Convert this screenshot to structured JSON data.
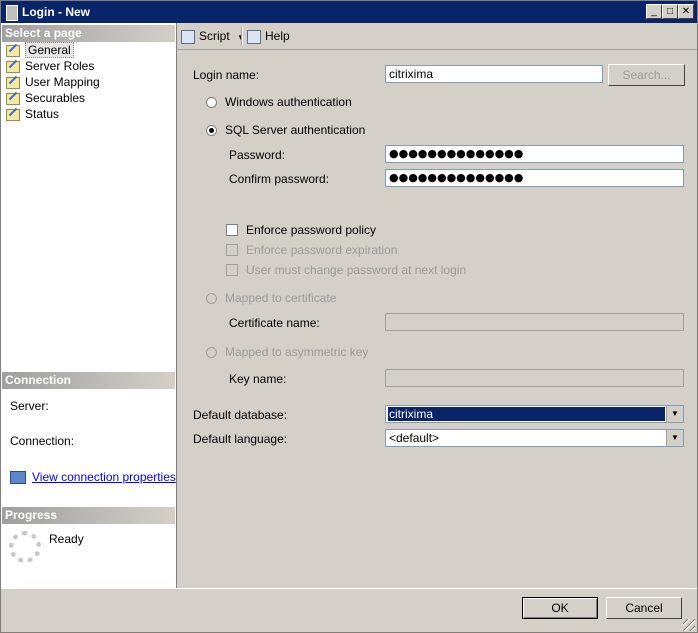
{
  "window": {
    "title": "Login - New"
  },
  "sidebar": {
    "select_header": "Select a page",
    "pages": [
      {
        "label": "General"
      },
      {
        "label": "Server Roles"
      },
      {
        "label": "User Mapping"
      },
      {
        "label": "Securables"
      },
      {
        "label": "Status"
      }
    ],
    "connection_header": "Connection",
    "server_label": "Server:",
    "connection_label": "Connection:",
    "view_link": "View connection properties",
    "progress_header": "Progress",
    "progress_status": "Ready"
  },
  "toolbar": {
    "script_label": "Script",
    "help_label": "Help"
  },
  "form": {
    "login_name_label": "Login name:",
    "login_name_value": "citrixima",
    "search_button": "Search...",
    "windows_auth": "Windows authentication",
    "sql_auth": "SQL Server authentication",
    "password_label": "Password:",
    "password_value": "●●●●●●●●●●●●●●",
    "confirm_label": "Confirm password:",
    "confirm_value": "●●●●●●●●●●●●●●",
    "enforce_policy": "Enforce password policy",
    "enforce_expiration": "Enforce password expiration",
    "must_change": "User must change password at next login",
    "mapped_cert": "Mapped to certificate",
    "cert_name_label": "Certificate name:",
    "mapped_key": "Mapped to asymmetric key",
    "key_name_label": "Key name:",
    "default_db_label": "Default database:",
    "default_db_value": "citrixima",
    "default_lang_label": "Default language:",
    "default_lang_value": "<default>"
  },
  "footer": {
    "ok": "OK",
    "cancel": "Cancel"
  }
}
